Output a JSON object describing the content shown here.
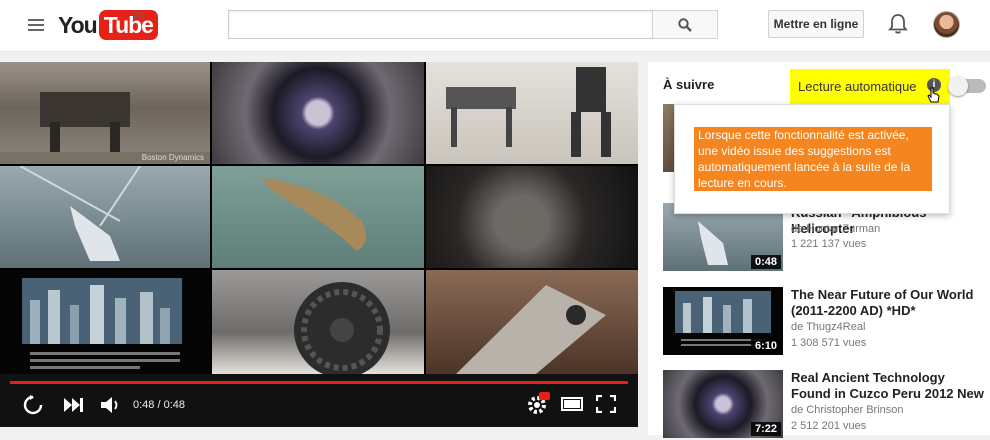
{
  "header": {
    "logo_you": "You",
    "logo_tube": "Tube",
    "region": "FR",
    "search_placeholder": "",
    "upload_label": "Mettre en ligne"
  },
  "player": {
    "progress": 1.0,
    "time": "0:48 / 0:48",
    "tile_credit": "Boston Dynamics",
    "accent_color": "#e62117"
  },
  "sidebar": {
    "up_next": "À suivre",
    "autoplay_label": "Lecture automatique",
    "autoplay_on": false,
    "tooltip": "Lorsque cette fonctionnalité est activée, une vidéo issue des suggestions est automatiquement lancée à la suite de la lecture en cours.",
    "videos": [
      {
        "title": "Russian \"Amphibious\" Helicopter",
        "author": "de Hontar Zurman",
        "views": "1 221 137 vues",
        "duration": "0:48"
      },
      {
        "title": "The Near Future of Our World (2011-2200 AD) *HD*",
        "author": "de Thugz4Real",
        "views": "1 308 571 vues",
        "duration": "6:10"
      },
      {
        "title": "Real Ancient Technology Found in Cuzco Peru 2012 New",
        "author": "de Christopher Brinson",
        "views": "2 512 201 vues",
        "duration": "7:22"
      }
    ]
  },
  "icons": [
    "menu-icon",
    "search-icon",
    "bell-icon",
    "replay-icon",
    "next-icon",
    "volume-icon",
    "settings-icon",
    "theater-icon",
    "fullscreen-icon",
    "info-icon",
    "cursor-icon"
  ]
}
